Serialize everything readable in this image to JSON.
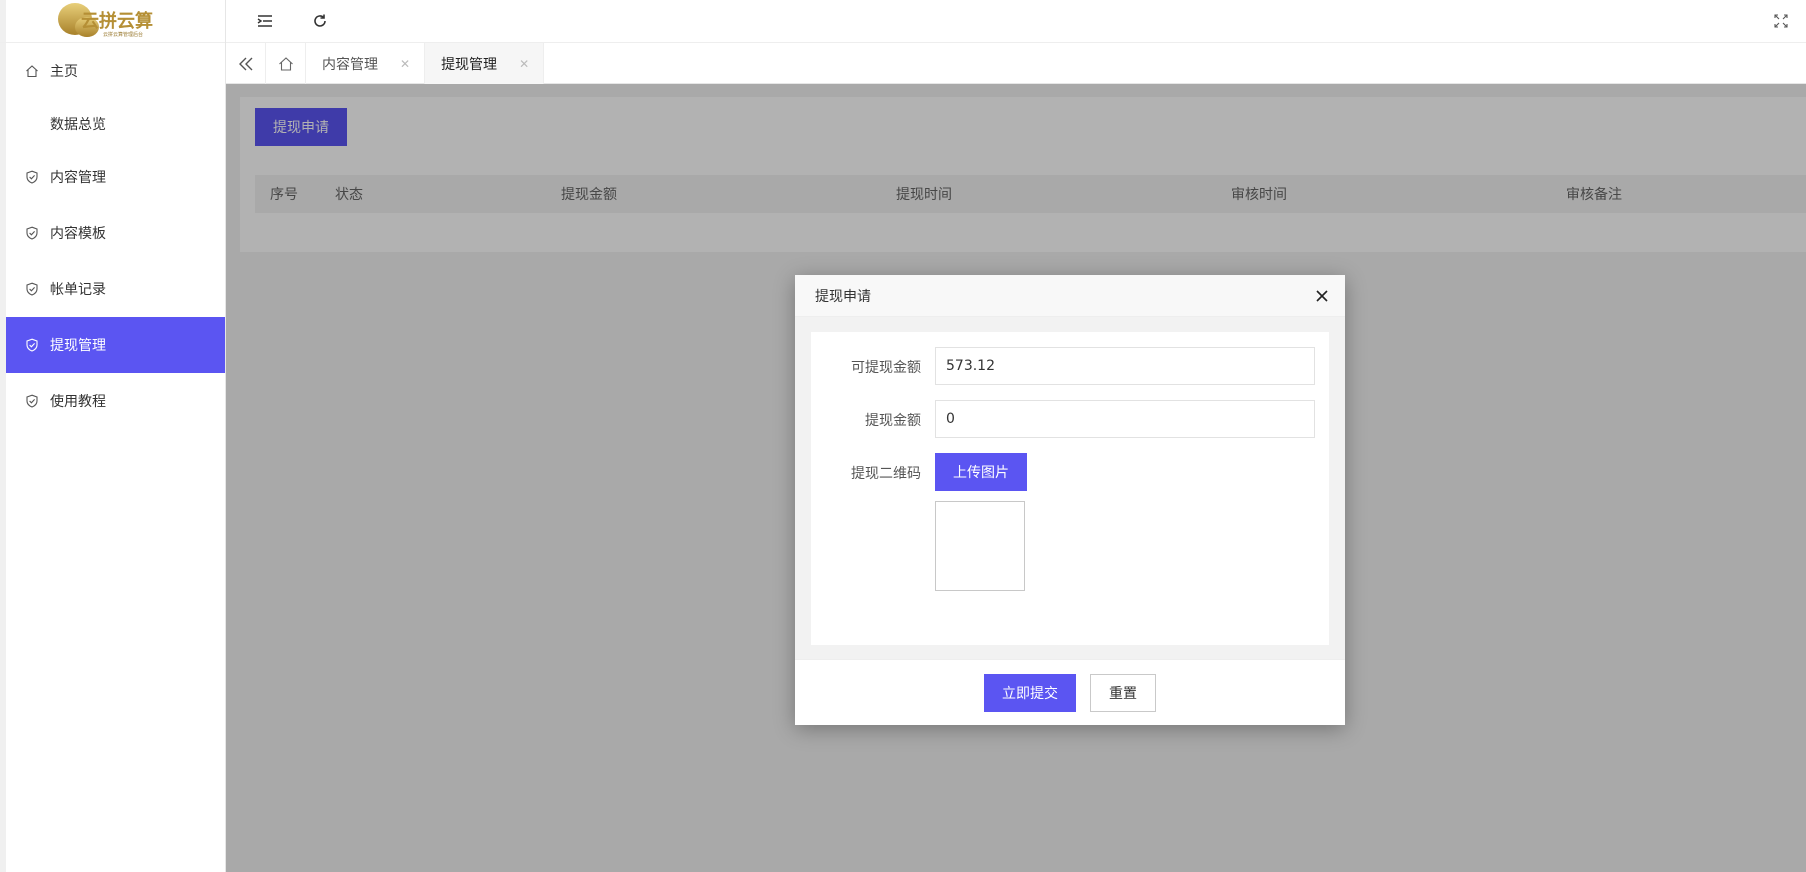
{
  "brand": {
    "logo_text": "云拼云算",
    "logo_sub": "云拼云算管理后台"
  },
  "sidebar": {
    "items": [
      {
        "label": "主页",
        "icon": "home-icon"
      },
      {
        "label": "数据总览",
        "icon": ""
      },
      {
        "label": "内容管理",
        "icon": "shield-check-icon"
      },
      {
        "label": "内容模板",
        "icon": "shield-check-icon"
      },
      {
        "label": "帐单记录",
        "icon": "shield-check-icon"
      },
      {
        "label": "提现管理",
        "icon": "shield-check-icon",
        "active": true
      },
      {
        "label": "使用教程",
        "icon": "shield-check-icon"
      }
    ]
  },
  "header": {
    "icons": [
      "menu-fold-icon",
      "refresh-icon",
      "fullscreen-icon"
    ]
  },
  "tabs": [
    {
      "label": "内容管理"
    },
    {
      "label": "提现管理",
      "active": true
    }
  ],
  "page": {
    "apply_button": "提现申请",
    "table_headers": [
      "序号",
      "状态",
      "提现金额",
      "提现时间",
      "审核时间",
      "审核备注"
    ]
  },
  "modal": {
    "title": "提现申请",
    "available_label": "可提现金额",
    "available_value": "573.12",
    "amount_label": "提现金额",
    "amount_value": "0",
    "qrcode_label": "提现二维码",
    "upload_button": "上传图片",
    "submit_button": "立即提交",
    "reset_button": "重置"
  },
  "colors": {
    "accent": "#5b55f2",
    "logo_gold": "#c9a640"
  }
}
